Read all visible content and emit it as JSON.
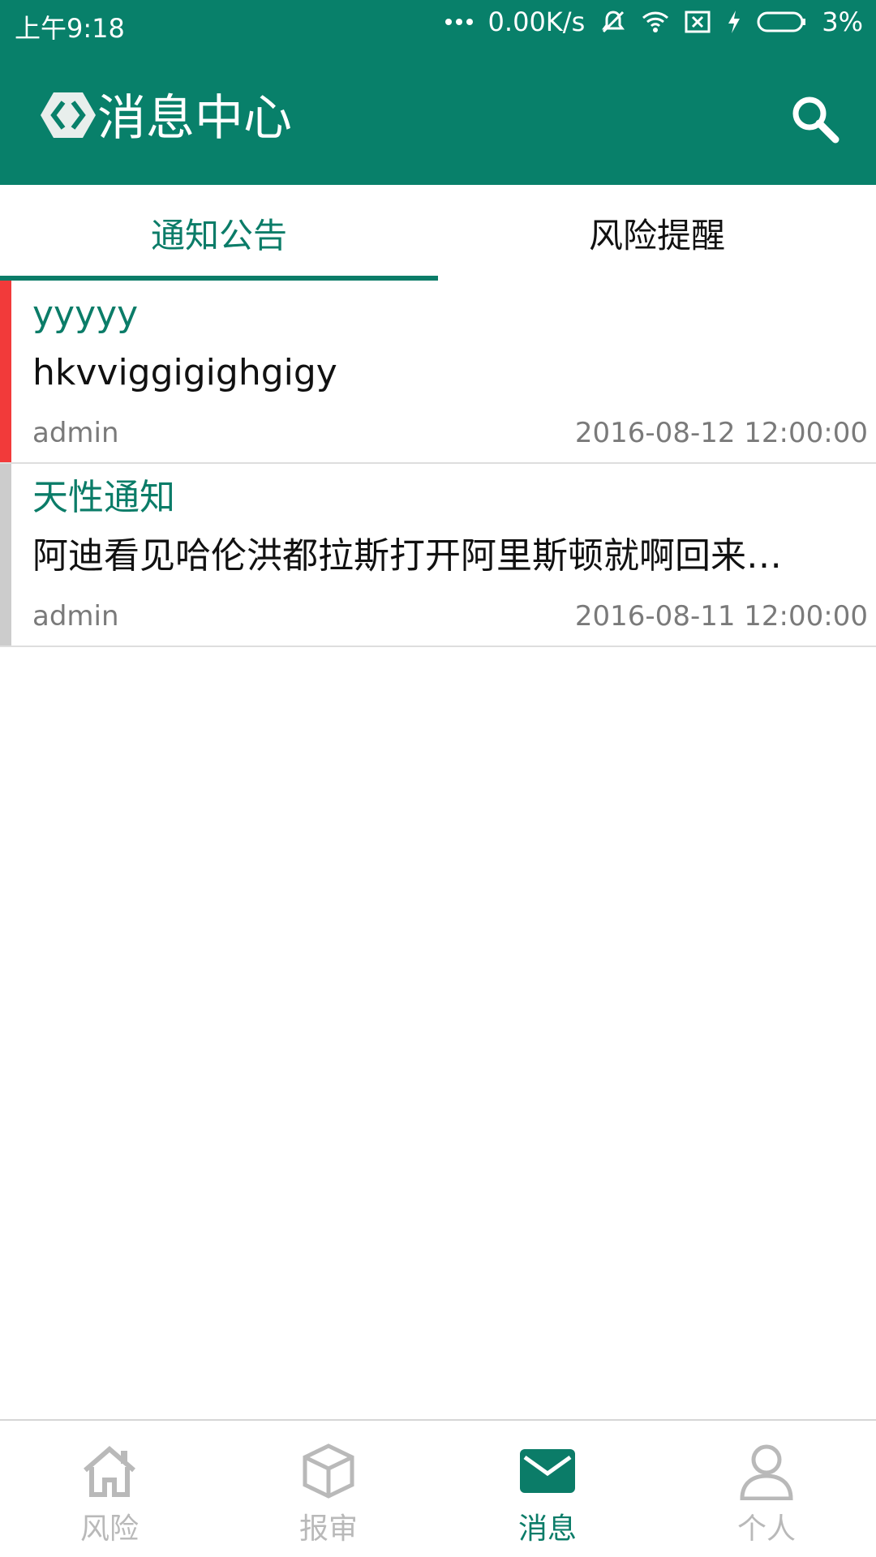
{
  "status_bar": {
    "time": "上午9:18",
    "network_speed": "0.00K/s",
    "battery": "3%",
    "icons": [
      "more-dots-icon",
      "mute-bell-icon",
      "wifi-icon",
      "sim-off-icon",
      "charging-icon",
      "battery-icon"
    ]
  },
  "header": {
    "title": "消息中心",
    "logo_icon": "app-logo-icon",
    "search_icon": "search-icon"
  },
  "tabs": [
    {
      "label": "通知公告",
      "active": true
    },
    {
      "label": "风险提醒",
      "active": false
    }
  ],
  "notices": [
    {
      "title": "yyyyy",
      "content": "hkvviggigighgigy",
      "author": "admin",
      "date": "2016-08-12 12:00:00",
      "indicator_color": "#F23A3A"
    },
    {
      "title": "天性通知",
      "content": "阿迪看见哈伦洪都拉斯打开阿里斯顿就啊回来…",
      "author": "admin",
      "date": "2016-08-11 12:00:00",
      "indicator_color": "#CCCCCC"
    }
  ],
  "bottom_nav": [
    {
      "label": "风险",
      "icon": "home-icon",
      "active": false
    },
    {
      "label": "报审",
      "icon": "cube-icon",
      "active": false
    },
    {
      "label": "消息",
      "icon": "mail-icon",
      "active": true
    },
    {
      "label": "个人",
      "icon": "person-icon",
      "active": false
    }
  ],
  "colors": {
    "primary": "#08806A",
    "accent": "#0B7C68",
    "unread": "#F23A3A",
    "read": "#CCCCCC",
    "inactive_nav": "#B9B9B9"
  }
}
